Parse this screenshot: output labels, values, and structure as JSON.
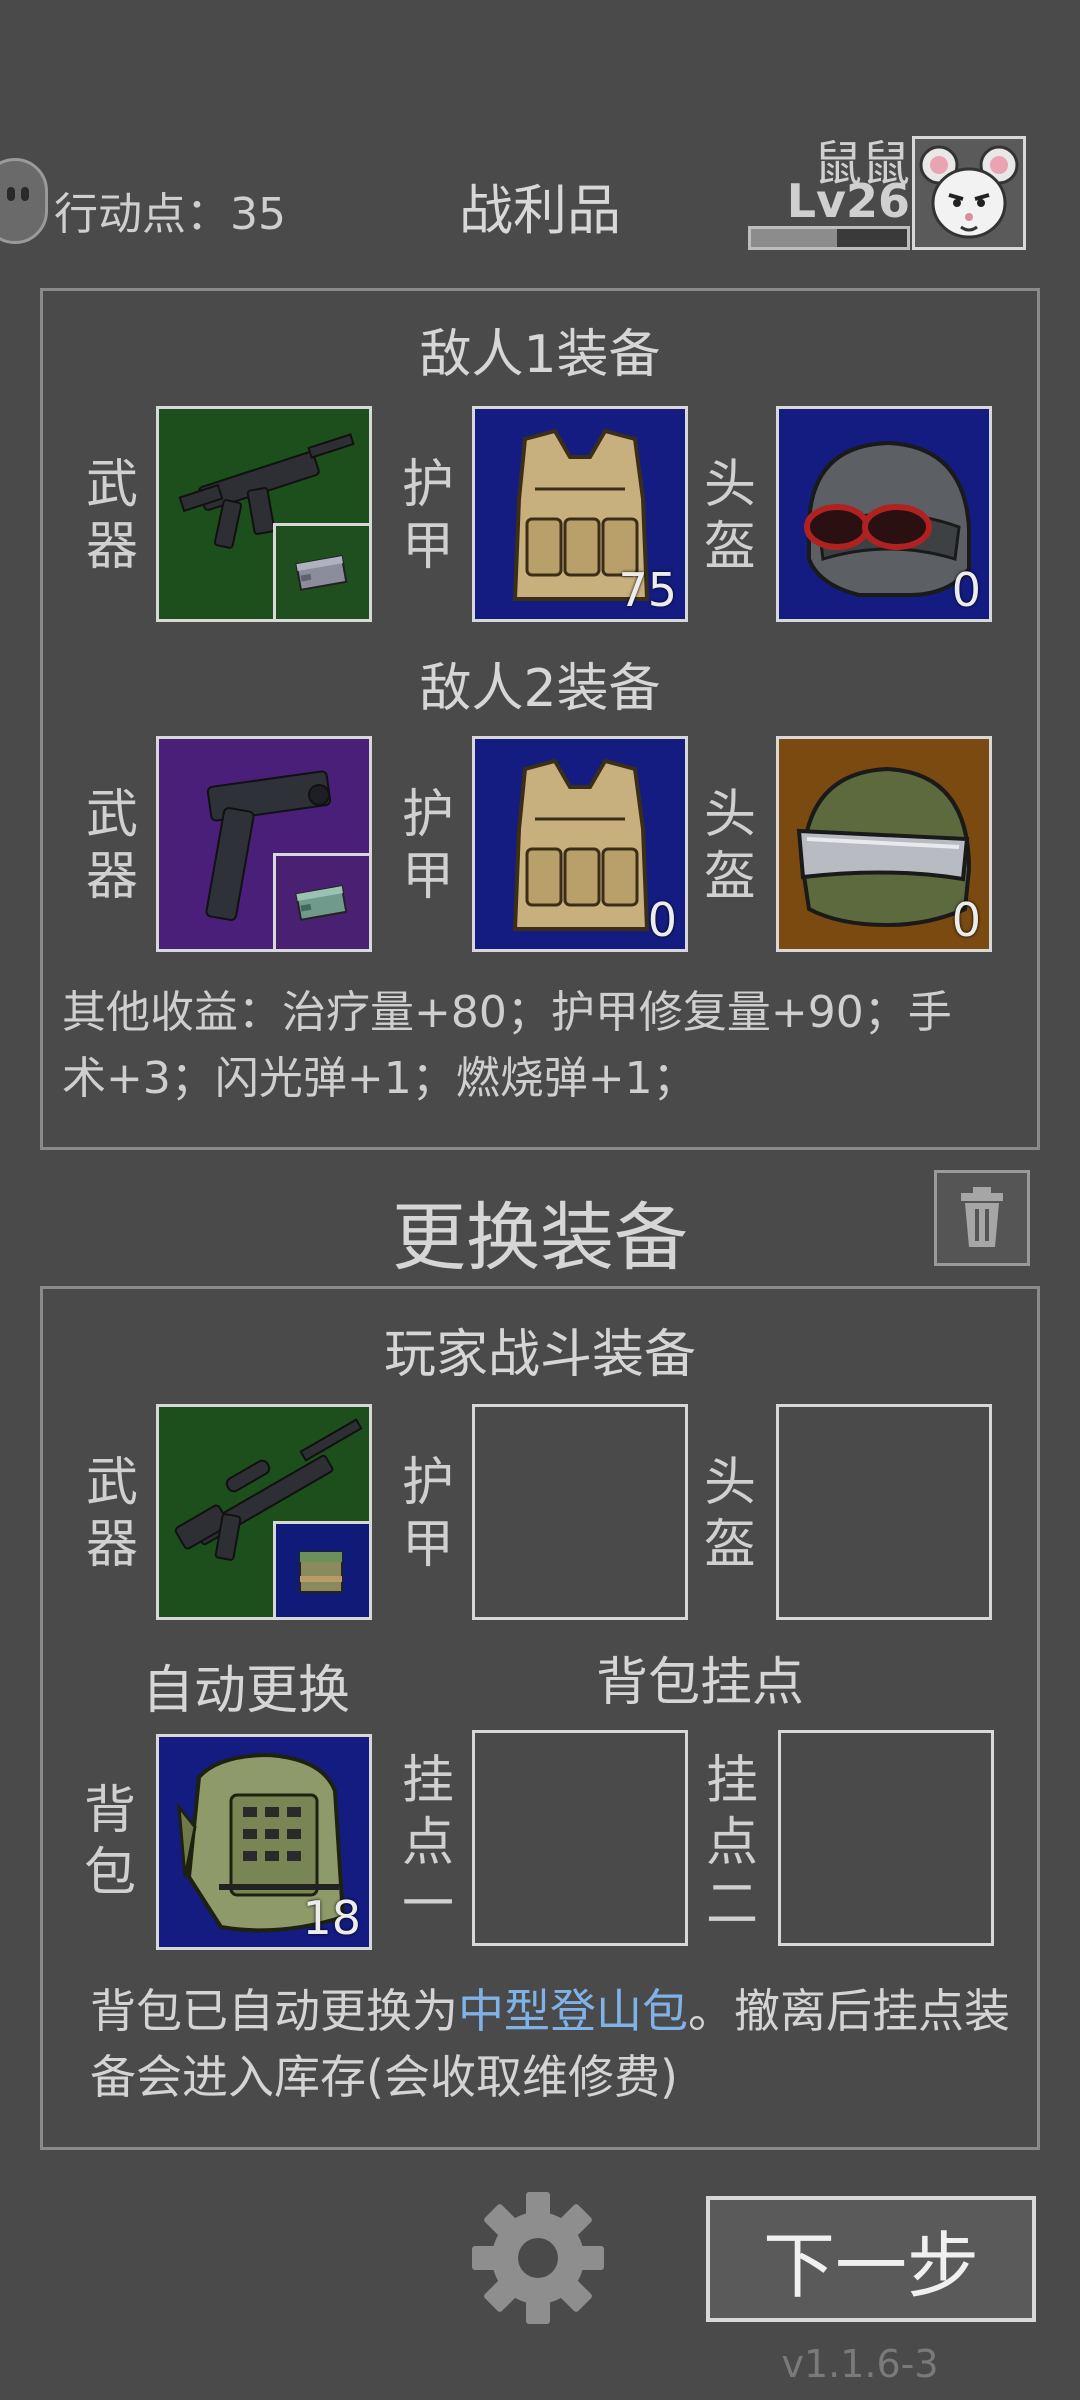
{
  "header": {
    "action_points": "行动点：35",
    "title": "战利品",
    "player_name": "鼠鼠",
    "player_level": "Lv26",
    "xp_fraction": 0.55
  },
  "loot": {
    "enemy1": {
      "title": "敌人1装备",
      "weapon_label": "武器",
      "armor_label": "护甲",
      "helmet_label": "头盔",
      "armor_count": "75",
      "helmet_count": "0"
    },
    "enemy2": {
      "title": "敌人2装备",
      "weapon_label": "武器",
      "armor_label": "护甲",
      "helmet_label": "头盔",
      "armor_count": "0",
      "helmet_count": "0"
    },
    "other_rewards": "其他收益：治疗量+80；护甲修复量+90；手术+3；闪光弹+1；燃烧弹+1；"
  },
  "swap": {
    "title": "更换装备"
  },
  "player": {
    "title": "玩家战斗装备",
    "weapon_label": "武器",
    "armor_label": "护甲",
    "helmet_label": "头盔",
    "auto_swap": "自动更换",
    "backpack_mounts_title": "背包挂点",
    "backpack_label": "背包",
    "backpack_count": "18",
    "mount1_label": "挂点一",
    "mount2_label": "挂点二",
    "note_prefix": "背包已自动更换为",
    "note_link": "中型登山包",
    "note_suffix": "。撤离后挂点装备会进入库存(会收取维修费)"
  },
  "footer": {
    "next_button": "下一步",
    "version": "v1.1.6-3"
  },
  "icons": [
    "face-icon",
    "mouse-avatar",
    "rifle-icon",
    "pistol-icon",
    "sniper-icon",
    "ammo-icon",
    "armor-vest-icon",
    "helmet-icon",
    "backpack-icon",
    "trash-icon",
    "gear-icon"
  ]
}
